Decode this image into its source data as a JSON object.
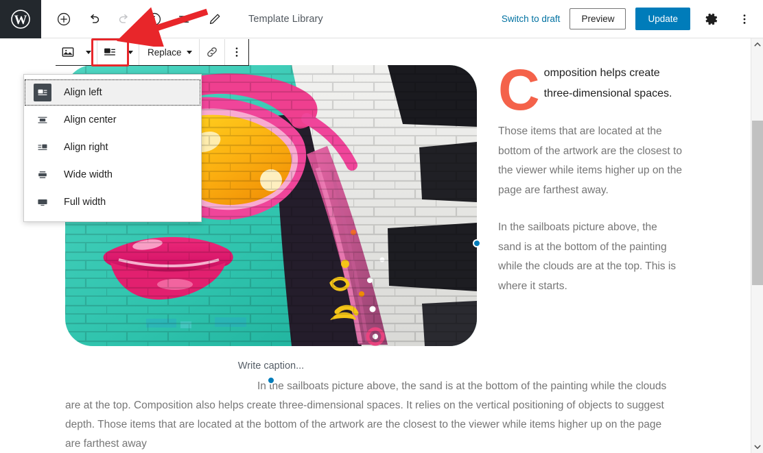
{
  "header": {
    "logo_icon": "wordpress-logo-icon",
    "tools": [
      {
        "name": "add-block-button",
        "icon": "plus-circle-icon",
        "label": "Add block",
        "disabled": false
      },
      {
        "name": "undo-button",
        "icon": "undo-icon",
        "label": "Undo",
        "disabled": false
      },
      {
        "name": "redo-button",
        "icon": "redo-icon",
        "label": "Redo",
        "disabled": true
      },
      {
        "name": "details-button",
        "icon": "info-circle-icon",
        "label": "Details",
        "disabled": false
      },
      {
        "name": "list-view-button",
        "icon": "list-view-icon",
        "label": "List view",
        "disabled": false
      },
      {
        "name": "edit-button",
        "icon": "pencil-icon",
        "label": "Edit",
        "disabled": false
      }
    ],
    "title": "Template Library",
    "switch_to_draft_label": "Switch to draft",
    "preview_label": "Preview",
    "update_label": "Update",
    "settings_icon": "gear-icon",
    "more_options_icon": "three-dots-vertical-icon"
  },
  "block_toolbar": {
    "block_type_icon": "image-icon",
    "block_type_caret_icon": "chevron-down-icon",
    "align_icon": "align-left-icon",
    "align_caret_icon": "chevron-down-icon",
    "replace_label": "Replace",
    "replace_caret_icon": "chevron-down-icon",
    "link_icon": "link-icon",
    "more_icon": "three-dots-vertical-icon"
  },
  "align_menu": {
    "items": [
      {
        "label": "Align left",
        "icon": "align-left-icon",
        "selected": true
      },
      {
        "label": "Align center",
        "icon": "align-center-icon",
        "selected": false
      },
      {
        "label": "Align right",
        "icon": "align-right-icon",
        "selected": false
      },
      {
        "label": "Wide width",
        "icon": "wide-width-icon",
        "selected": false
      },
      {
        "label": "Full width",
        "icon": "full-width-icon",
        "selected": false
      }
    ]
  },
  "content": {
    "image_alt": "Graffiti mural of a face with pink sunglasses and lips on a teal brick wall",
    "caption_placeholder": "Write caption...",
    "dropcap_letter": "C",
    "dropcap_paragraph": "omposition helps create three-dimensional spaces.",
    "right_paragraph_1": "Those items that are located at the bottom of the artwork are the closest to the viewer while items higher up on the page are farthest away.",
    "right_paragraph_2": "In the sailboats picture above, the sand is at the bottom of the painting while the clouds are at the top. This is where it starts.",
    "bottom_paragraph": "In the sailboats picture above, the sand is at the bottom of the painting while the clouds are at the top. Composition also helps create three-dimensional spaces. It relies on the vertical positioning of objects to suggest depth. Those items that are located at the bottom of the artwork are the closest to the viewer while items higher up on the page are farthest away"
  },
  "annotation": {
    "highlight_color": "#e8262a",
    "arrow_icon": "red-arrow-icon"
  },
  "colors": {
    "accent_blue": "#007cba",
    "link_blue": "#0071a1",
    "dropcap": "#f4624a",
    "admin_bar": "#23282d",
    "body_text": "#767676"
  },
  "scrollbar": {
    "up_icon": "chevron-up-icon",
    "down_icon": "chevron-down-icon"
  }
}
